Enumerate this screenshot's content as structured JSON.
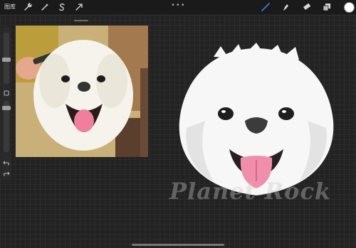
{
  "topbar": {
    "gallery_label": "图库",
    "more_label": "•••",
    "tools": [
      {
        "name": "wrench-icon"
      },
      {
        "name": "magic-wand-icon"
      },
      {
        "name": "selection-s-icon"
      },
      {
        "name": "transform-arrow-icon"
      },
      {
        "name": "brush-icon",
        "active": true
      },
      {
        "name": "smudge-icon"
      },
      {
        "name": "eraser-icon"
      },
      {
        "name": "layers-icon"
      }
    ],
    "color": "#ffffff"
  },
  "sidebar": {
    "brush_size_level": 0.4,
    "opacity_level": 0.3,
    "buttons": [
      "square-modify-icon",
      "undo-icon",
      "redo-icon"
    ]
  },
  "canvas": {
    "watermark_text": "Planet Rock"
  },
  "colors": {
    "accent": "#3a7bd5",
    "canvas": "#222222",
    "topbar": "#1a1a1a"
  }
}
